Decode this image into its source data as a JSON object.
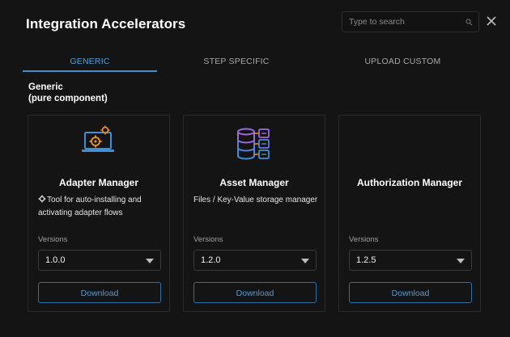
{
  "modal": {
    "title": "Integration Accelerators",
    "close_icon": "close-icon"
  },
  "search": {
    "placeholder": "Type to search",
    "value": "",
    "icon": "search-icon"
  },
  "tabs": [
    {
      "label": "GENERIC",
      "active": true
    },
    {
      "label": "STEP SPECIFIC",
      "active": false
    },
    {
      "label": "UPLOAD CUSTOM",
      "active": false
    }
  ],
  "section": {
    "title": "Generic",
    "subtitle": "(pure component)"
  },
  "cards": [
    {
      "name": "Adapter Manager",
      "icon": "laptop-gears-icon",
      "description_icon": "gear-icon",
      "description": "Tool for auto-installing and activating adapter flows",
      "versions_label": "Versions",
      "version": "1.0.0",
      "download_label": "Download"
    },
    {
      "name": "Asset Manager",
      "icon": "database-files-icon",
      "description": "Files / Key-Value storage manager",
      "versions_label": "Versions",
      "version": "1.2.0",
      "download_label": "Download"
    },
    {
      "name": "Authorization Manager",
      "description": "",
      "versions_label": "Versions",
      "version": "1.2.5",
      "download_label": "Download"
    }
  ],
  "colors": {
    "background": "#141414",
    "accent": "#4aa3e6",
    "icon_blue": "#3d8fd6",
    "icon_orange": "#e88a2a",
    "icon_purple": "#9b6bd6"
  }
}
